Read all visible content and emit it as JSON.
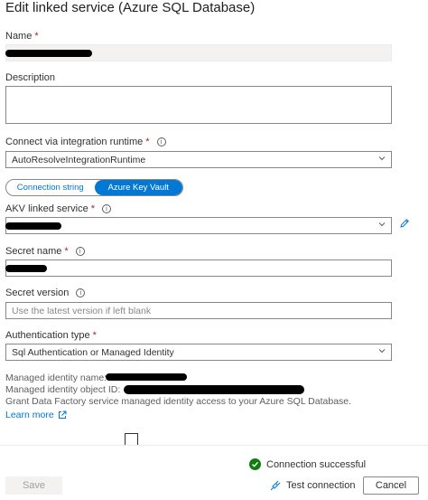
{
  "panel": {
    "title": "Edit linked service (Azure SQL Database)"
  },
  "name_field": {
    "label": "Name",
    "required_mark": "*"
  },
  "description_field": {
    "label": "Description",
    "value": ""
  },
  "runtime_field": {
    "label": "Connect via integration runtime",
    "required_mark": "*",
    "value": "AutoResolveIntegrationRuntime"
  },
  "auth_mode_toggle": {
    "options": [
      "Connection string",
      "Azure Key Vault"
    ],
    "selected": "Azure Key Vault"
  },
  "akv_field": {
    "label": "AKV linked service",
    "required_mark": "*"
  },
  "secret_name_field": {
    "label": "Secret name",
    "required_mark": "*"
  },
  "secret_version_field": {
    "label": "Secret version",
    "placeholder": "Use the latest version if left blank"
  },
  "auth_type_field": {
    "label": "Authentication type",
    "required_mark": "*",
    "value": "Sql Authentication or Managed Identity"
  },
  "managed_identity": {
    "name_label": "Managed identity name:",
    "object_id_label": "Managed identity object ID:",
    "grant_text": "Grant Data Factory service managed identity access to your Azure SQL Database.",
    "learn_more": "Learn more"
  },
  "footer": {
    "status_text": "Connection successful",
    "test_label": "Test connection",
    "save_label": "Save",
    "cancel_label": "Cancel"
  },
  "colors": {
    "accent": "#0078d4",
    "success": "#107c10",
    "required": "#a4262c"
  },
  "icons": [
    "info-icon",
    "chevron-down-icon",
    "edit-pencil-icon",
    "external-link-icon",
    "checkmark-circle-icon",
    "plug-icon"
  ]
}
